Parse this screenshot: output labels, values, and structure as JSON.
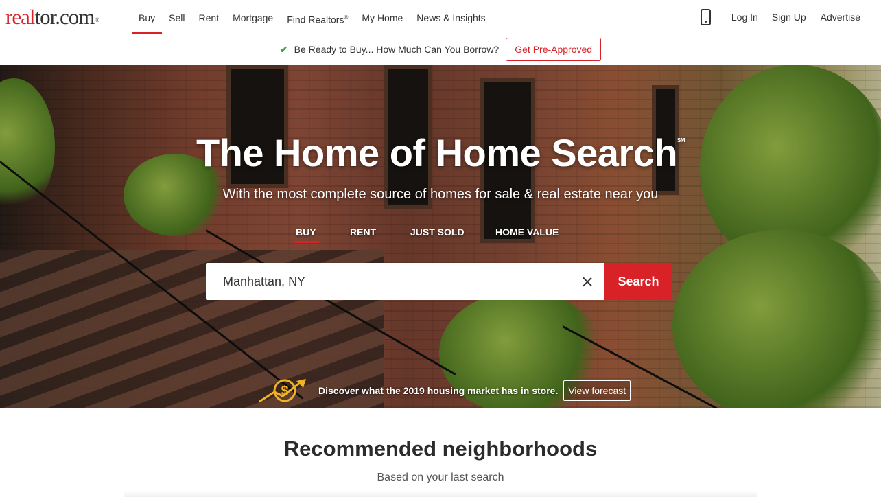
{
  "brand": {
    "logo_red": "real",
    "logo_dark": "tor.com",
    "logo_mark": "®",
    "accent": "#d92228"
  },
  "nav": {
    "items": [
      {
        "label": "Buy",
        "active": true
      },
      {
        "label": "Sell"
      },
      {
        "label": "Rent"
      },
      {
        "label": "Mortgage"
      },
      {
        "label": "Find Realtors"
      },
      {
        "label": "My Home"
      },
      {
        "label": "News & Insights"
      }
    ],
    "find_realtors_mark": "®",
    "login": "Log In",
    "signup": "Sign Up",
    "advertise": "Advertise",
    "phone_icon": "mobile-phone-icon"
  },
  "promo": {
    "text": "Be Ready to Buy... How Much Can You Borrow?",
    "button": "Get Pre-Approved",
    "icon": "checkmark-icon"
  },
  "hero": {
    "title": "The Home of Home Search",
    "title_mark": "SM",
    "subtitle": "With the most complete source of homes for sale & real estate near you",
    "tabs": [
      {
        "label": "BUY",
        "active": true
      },
      {
        "label": "RENT"
      },
      {
        "label": "JUST SOLD"
      },
      {
        "label": "HOME VALUE"
      }
    ],
    "search_value": "Manhattan, NY",
    "search_button": "Search",
    "forecast_text": "Discover what the 2019 housing market has in store.",
    "forecast_button": "View forecast"
  },
  "recommended": {
    "title": "Recommended neighborhoods",
    "subtitle": "Based on your last search"
  }
}
